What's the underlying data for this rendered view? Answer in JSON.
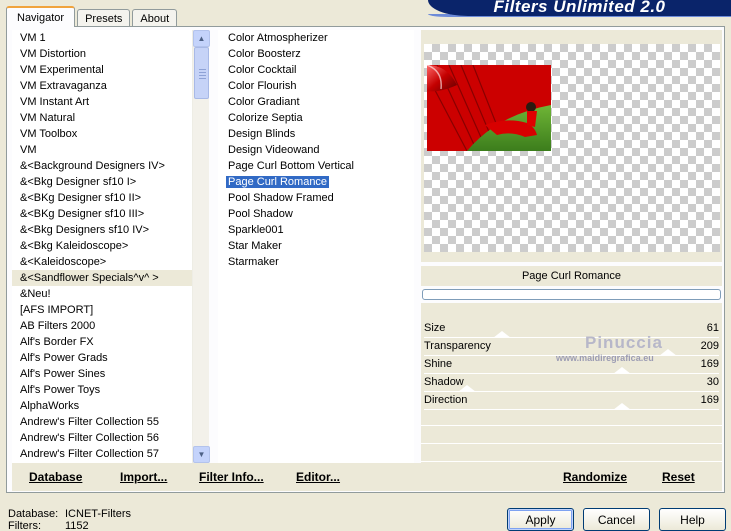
{
  "tabs": [
    "Navigator",
    "Presets",
    "About"
  ],
  "banner_title": "Filters Unlimited 2.0",
  "categories": [
    "VM 1",
    "VM Distortion",
    "VM Experimental",
    "VM Extravaganza",
    "VM Instant Art",
    "VM Natural",
    "VM Toolbox",
    "VM",
    "&<Background Designers IV>",
    "&<Bkg Designer sf10 I>",
    "&<BKg Designer sf10 II>",
    "&<BKg Designer sf10 III>",
    "&<Bkg Designers sf10 IV>",
    "&<Bkg Kaleidoscope>",
    "&<Kaleidoscope>",
    "&<Sandflower Specials^v^ >",
    "&Neu!",
    "[AFS IMPORT]",
    "AB Filters 2000",
    "Alf's Border FX",
    "Alf's Power Grads",
    "Alf's Power Sines",
    "Alf's Power Toys",
    "AlphaWorks",
    "Andrew's Filter Collection 55",
    "Andrew's Filter Collection 56",
    "Andrew's Filter Collection 57"
  ],
  "selected_category_index": 15,
  "filters": [
    "Color Atmospherizer",
    "Color Boosterz",
    "Color Cocktail",
    "Color Flourish",
    "Color Gradiant",
    "Colorize Septia",
    "Design Blinds",
    "Design Videowand",
    "Page Curl Bottom Vertical",
    "Page Curl Romance",
    "Pool Shadow Framed",
    "Pool Shadow",
    "Sparkle001",
    "Star Maker",
    "Starmaker"
  ],
  "selected_filter_index": 9,
  "current_filter": "Page Curl Romance",
  "parameters": [
    {
      "label": "Size",
      "value": "61",
      "fraction": 0.24
    },
    {
      "label": "Transparency",
      "value": "209",
      "fraction": 0.82
    },
    {
      "label": "Shine",
      "value": "169",
      "fraction": 0.66
    },
    {
      "label": "Shadow",
      "value": "30",
      "fraction": 0.12
    },
    {
      "label": "Direction",
      "value": "169",
      "fraction": 0.66
    }
  ],
  "watermark": {
    "name": "Pinuccia",
    "url": "www.maidiregrafica.eu"
  },
  "links": {
    "database": "Database",
    "import": "Import...",
    "filter_info": "Filter Info...",
    "editor": "Editor...",
    "randomize": "Randomize",
    "reset": "Reset"
  },
  "footer": {
    "database_label": "Database:",
    "database_value": "ICNET-Filters",
    "filters_label": "Filters:",
    "filters_value": "1152"
  },
  "buttons": {
    "apply": "Apply",
    "cancel": "Cancel",
    "help": "Help"
  },
  "colors": {
    "selection": "#316ac5",
    "panel": "#ece9d8",
    "banner": "#0a246a"
  }
}
